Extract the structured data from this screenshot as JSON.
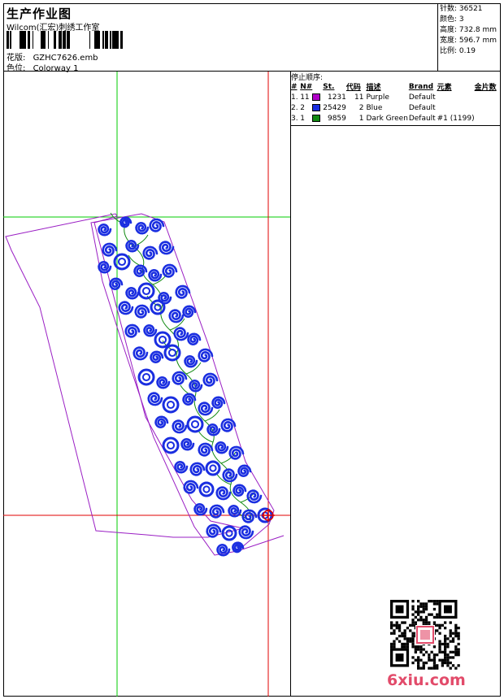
{
  "header": {
    "title": "生产作业图",
    "company": "Wilcom(汇宏)刺绣工作室",
    "design_label": "花版:",
    "design_value": "GZHC7626.emb",
    "colorway_label": "色位:",
    "colorway_value": "Colorway 1"
  },
  "stats": {
    "stitches": "针数: 36521",
    "colors": "颜色: 3",
    "height": "高度: 732.8 mm",
    "width": "宽度: 596.7 mm",
    "scale": "比例: 0.19"
  },
  "sequence": {
    "title": "停止顺序:",
    "headers": [
      "#",
      "N#",
      "",
      "St.",
      "代码",
      "描述",
      "Brand",
      "元素",
      "金片数"
    ],
    "rows": [
      {
        "idx": "1.",
        "n": "11",
        "color": "#b000c8",
        "st": "1231",
        "code": "11",
        "desc": "Purple",
        "brand": "Default",
        "element": "",
        "sequins": ""
      },
      {
        "idx": "2.",
        "n": "2",
        "color": "#1a2ee0",
        "st": "25429",
        "code": "2",
        "desc": "Blue",
        "brand": "Default",
        "element": "",
        "sequins": ""
      },
      {
        "idx": "3.",
        "n": "1",
        "color": "#128a12",
        "st": "9859",
        "code": "1",
        "desc": "Dark Green",
        "brand": "Default",
        "element": "#1 (1199)",
        "sequins": ""
      }
    ]
  },
  "design": {
    "guide_green": "#00cc00",
    "guide_red": "#e00000",
    "outline_color": "#9a1fc4",
    "spiral_color": "#1a2ee0",
    "vine_color": "#128a12"
  },
  "watermark": {
    "text": "6xiu.com",
    "color": "#e24b6a"
  }
}
